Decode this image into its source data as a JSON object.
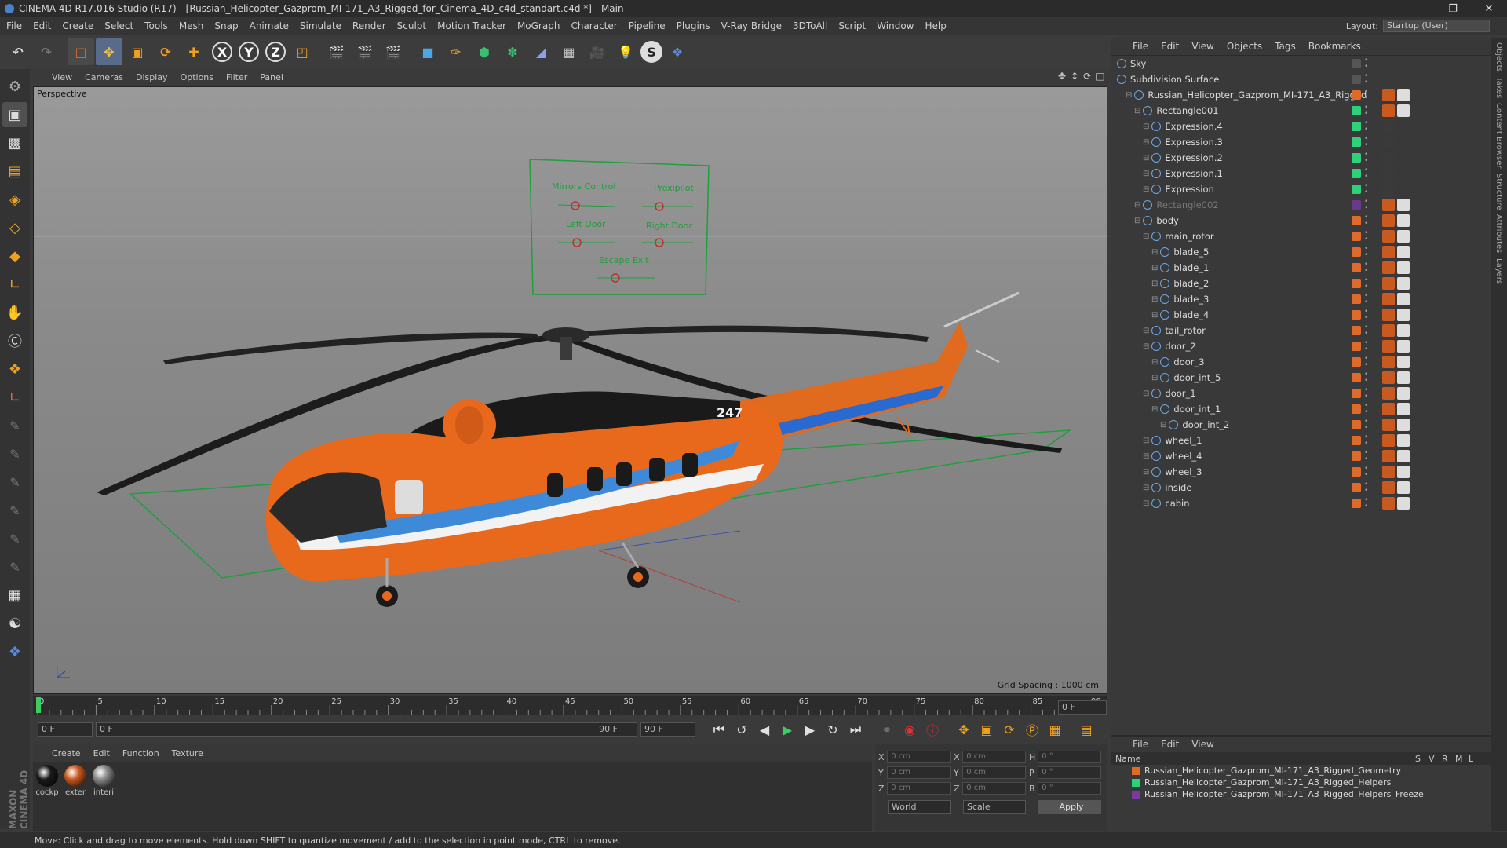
{
  "window": {
    "title": "CINEMA 4D R17.016 Studio (R17) - [Russian_Helicopter_Gazprom_MI-171_A3_Rigged_for_Cinema_4D_c4d_standart.c4d *] - Main"
  },
  "menu": [
    "File",
    "Edit",
    "Create",
    "Select",
    "Tools",
    "Mesh",
    "Snap",
    "Animate",
    "Simulate",
    "Render",
    "Sculpt",
    "Motion Tracker",
    "MoGraph",
    "Character",
    "Pipeline",
    "Plugins",
    "V-Ray Bridge",
    "3DToAll",
    "Script",
    "Window",
    "Help"
  ],
  "layout": {
    "label": "Layout:",
    "value": "Startup (User)"
  },
  "viewport": {
    "menu": [
      "View",
      "Cameras",
      "Display",
      "Options",
      "Filter",
      "Panel"
    ],
    "label": "Perspective",
    "grid_spacing": "Grid Spacing : 1000 cm",
    "controller_labels": [
      "Mirrors Control",
      "Proxipilot",
      "Left Door",
      "Right Door",
      "Escape Exit"
    ],
    "tail_number": "247"
  },
  "timeline": {
    "ticks": [
      "0",
      "5",
      "10",
      "15",
      "20",
      "25",
      "30",
      "35",
      "40",
      "45",
      "50",
      "55",
      "60",
      "65",
      "70",
      "75",
      "80",
      "85",
      "90"
    ],
    "current_frame": "0 F",
    "start": "0 F",
    "range_start": "0 F",
    "range_end": "90 F",
    "end": "90 F"
  },
  "materials": {
    "menu": [
      "Create",
      "Edit",
      "Function",
      "Texture"
    ],
    "items": [
      {
        "name": "cockp",
        "color": "#1a1a1a"
      },
      {
        "name": "exter",
        "color": "#c85a20"
      },
      {
        "name": "interi",
        "color": "#8a8a8a"
      }
    ]
  },
  "coords": {
    "rows": [
      {
        "a": "X",
        "av": "0 cm",
        "b": "X",
        "bv": "0 cm",
        "c": "H",
        "cv": "0 °"
      },
      {
        "a": "Y",
        "av": "0 cm",
        "b": "Y",
        "bv": "0 cm",
        "c": "P",
        "cv": "0 °"
      },
      {
        "a": "Z",
        "av": "0 cm",
        "b": "Z",
        "bv": "0 cm",
        "c": "B",
        "cv": "0 °"
      }
    ],
    "mode": "World",
    "scale": "Scale",
    "apply": "Apply"
  },
  "status": "Move: Click and drag to move elements. Hold down SHIFT to quantize movement / add to the selection in point mode, CTRL to remove.",
  "object_manager": {
    "menu": [
      "File",
      "Edit",
      "View",
      "Objects",
      "Tags",
      "Bookmarks"
    ],
    "objects": [
      {
        "name": "Sky",
        "depth": 0,
        "ctrl": "#555555"
      },
      {
        "name": "Subdivision Surface",
        "depth": 0,
        "ctrl": "#555555"
      },
      {
        "name": "Russian_Helicopter_Gazprom_MI-171_A3_Rigged",
        "depth": 1,
        "ctrl": "#e06a2a"
      },
      {
        "name": "Rectangle001",
        "depth": 2,
        "ctrl": "#2fd07a"
      },
      {
        "name": "Expression.4",
        "depth": 3,
        "ctrl": "#2fd07a"
      },
      {
        "name": "Expression.3",
        "depth": 3,
        "ctrl": "#2fd07a"
      },
      {
        "name": "Expression.2",
        "depth": 3,
        "ctrl": "#2fd07a"
      },
      {
        "name": "Expression.1",
        "depth": 3,
        "ctrl": "#2fd07a"
      },
      {
        "name": "Expression",
        "depth": 3,
        "ctrl": "#2fd07a"
      },
      {
        "name": "Rectangle002",
        "depth": 2,
        "ctrl": "#6a3a8a"
      },
      {
        "name": "body",
        "depth": 2,
        "ctrl": "#e06a2a"
      },
      {
        "name": "main_rotor",
        "depth": 3,
        "ctrl": "#e06a2a"
      },
      {
        "name": "blade_5",
        "depth": 4,
        "ctrl": "#e06a2a"
      },
      {
        "name": "blade_1",
        "depth": 4,
        "ctrl": "#e06a2a"
      },
      {
        "name": "blade_2",
        "depth": 4,
        "ctrl": "#e06a2a"
      },
      {
        "name": "blade_3",
        "depth": 4,
        "ctrl": "#e06a2a"
      },
      {
        "name": "blade_4",
        "depth": 4,
        "ctrl": "#e06a2a"
      },
      {
        "name": "tail_rotor",
        "depth": 3,
        "ctrl": "#e06a2a"
      },
      {
        "name": "door_2",
        "depth": 3,
        "ctrl": "#e06a2a"
      },
      {
        "name": "door_3",
        "depth": 4,
        "ctrl": "#e06a2a"
      },
      {
        "name": "door_int_5",
        "depth": 4,
        "ctrl": "#e06a2a"
      },
      {
        "name": "door_1",
        "depth": 3,
        "ctrl": "#e06a2a"
      },
      {
        "name": "door_int_1",
        "depth": 4,
        "ctrl": "#e06a2a"
      },
      {
        "name": "door_int_2",
        "depth": 5,
        "ctrl": "#e06a2a"
      },
      {
        "name": "wheel_1",
        "depth": 3,
        "ctrl": "#e06a2a"
      },
      {
        "name": "wheel_4",
        "depth": 3,
        "ctrl": "#e06a2a"
      },
      {
        "name": "wheel_3",
        "depth": 3,
        "ctrl": "#e06a2a"
      },
      {
        "name": "inside",
        "depth": 3,
        "ctrl": "#e06a2a"
      },
      {
        "name": "cabin",
        "depth": 3,
        "ctrl": "#e06a2a"
      }
    ]
  },
  "layer_manager": {
    "menu": [
      "File",
      "Edit",
      "View"
    ],
    "header": "Name",
    "columns": [
      "S",
      "V",
      "R",
      "M",
      "L"
    ],
    "layers": [
      {
        "name": "Russian_Helicopter_Gazprom_MI-171_A3_Rigged_Geometry",
        "color": "#e06a2a"
      },
      {
        "name": "Russian_Helicopter_Gazprom_MI-171_A3_Rigged_Helpers",
        "color": "#2fd07a"
      },
      {
        "name": "Russian_Helicopter_Gazprom_MI-171_A3_Rigged_Helpers_Freeze",
        "color": "#7a3aa0"
      }
    ]
  },
  "side_tabs": [
    "Objects",
    "Takes",
    "Content Browser",
    "Structure",
    "Attributes",
    "Layers"
  ],
  "maxon": "MAXON CINEMA 4D"
}
